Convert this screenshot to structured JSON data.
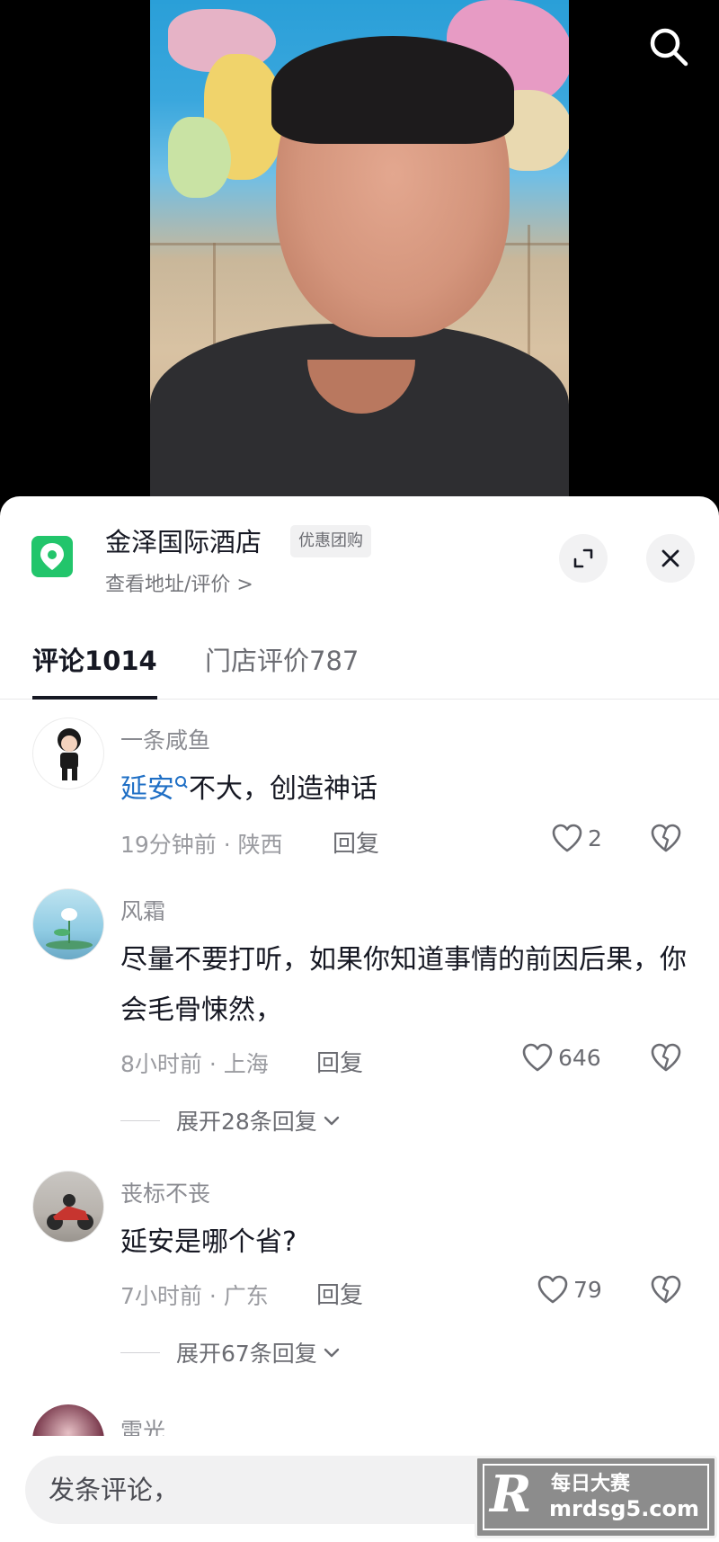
{
  "poi": {
    "name": "金泽国际酒店",
    "badge": "优惠团购",
    "subtitle": "查看地址/评价 >"
  },
  "tabs": {
    "comments_label": "评论",
    "comments_count": "1014",
    "reviews_label": "门店评价",
    "reviews_count": "787"
  },
  "comments": [
    {
      "user": "一条咸鱼",
      "link_text": "延安",
      "text": "不大，创造神话",
      "time_location": "19分钟前 · 陕西",
      "reply_label": "回复",
      "likes": "2"
    },
    {
      "user": "风霜",
      "text": "尽量不要打听，如果你知道事情的前因后果，你会毛骨悚然，",
      "time_location": "8小时前 · 上海",
      "reply_label": "回复",
      "likes": "646",
      "expand_replies": "展开28条回复"
    },
    {
      "user": "丧标不丧",
      "text": "延安是哪个省?",
      "time_location": "7小时前 · 广东",
      "reply_label": "回复",
      "likes": "79",
      "expand_replies": "展开67条回复"
    },
    {
      "user": "雷光"
    }
  ],
  "input": {
    "placeholder": "发条评论，"
  },
  "watermark": {
    "logo_letter": "R",
    "name": "每日大赛",
    "url": "mrdsg5.com"
  },
  "colors": {
    "poi_pin": "#22c56b",
    "link": "#1f6fc5",
    "tab_active": "#161823"
  },
  "icons": [
    "search-icon",
    "location-pin-icon",
    "expand-icon",
    "close-icon",
    "search-topic-icon",
    "heart-icon",
    "broken-heart-icon",
    "chevron-down-icon"
  ]
}
